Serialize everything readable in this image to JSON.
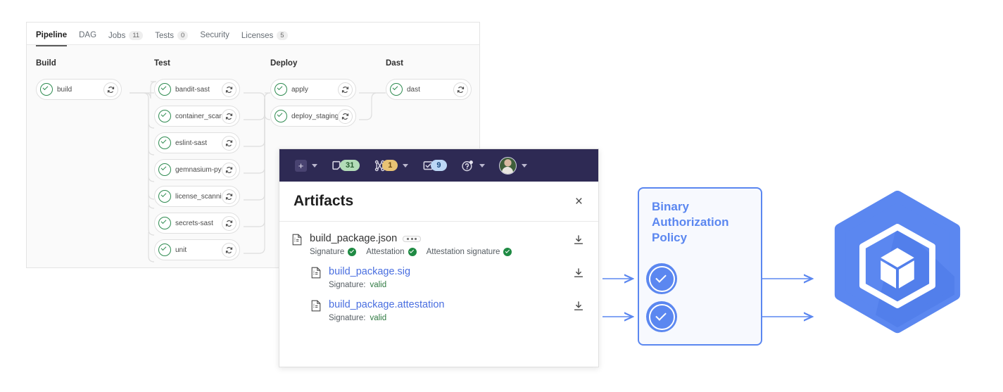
{
  "pipeline": {
    "tabs": [
      {
        "label": "Pipeline",
        "badge": null,
        "active": true
      },
      {
        "label": "DAG",
        "badge": null,
        "active": false
      },
      {
        "label": "Jobs",
        "badge": "11",
        "active": false
      },
      {
        "label": "Tests",
        "badge": "0",
        "active": false
      },
      {
        "label": "Security",
        "badge": null,
        "active": false
      },
      {
        "label": "Licenses",
        "badge": "5",
        "active": false
      }
    ],
    "stages": [
      {
        "name": "Build",
        "jobs": [
          {
            "name": "build",
            "status": "passed",
            "action": "retry"
          }
        ]
      },
      {
        "name": "Test",
        "jobs": [
          {
            "name": "bandit-sast",
            "status": "passed",
            "action": "retry"
          },
          {
            "name": "container_scan...",
            "status": "passed",
            "action": "retry"
          },
          {
            "name": "eslint-sast",
            "status": "passed",
            "action": "retry"
          },
          {
            "name": "gemnasium-pyt...",
            "status": "passed",
            "action": "retry"
          },
          {
            "name": "license_scanning",
            "status": "passed",
            "action": "retry"
          },
          {
            "name": "secrets-sast",
            "status": "passed",
            "action": "retry"
          },
          {
            "name": "unit",
            "status": "passed",
            "action": "retry"
          }
        ]
      },
      {
        "name": "Deploy",
        "jobs": [
          {
            "name": "apply",
            "status": "passed",
            "action": "retry"
          },
          {
            "name": "deploy_staging",
            "status": "passed",
            "action": "retry"
          }
        ]
      },
      {
        "name": "Dast",
        "jobs": [
          {
            "name": "dast",
            "status": "passed",
            "action": "retry"
          }
        ]
      }
    ]
  },
  "navbar": {
    "plus_icon": "plus-icon",
    "items": [
      {
        "icon": "issues-icon",
        "count": "31",
        "color": "#b3dcb8",
        "text_color": "#275c30",
        "chevron": false
      },
      {
        "icon": "merge-request-icon",
        "count": "1",
        "color": "#e8c374",
        "text_color": "#6b4a12",
        "chevron": true
      },
      {
        "icon": "todos-icon",
        "count": "9",
        "color": "#bcd7f5",
        "text_color": "#1b4a80",
        "chevron": false
      },
      {
        "icon": "help-icon",
        "count": null,
        "color": null,
        "text_color": null,
        "chevron": true
      }
    ],
    "avatar_alt": "user-avatar"
  },
  "artifacts": {
    "title": "Artifacts",
    "close_label": "×",
    "rows": [
      {
        "name": "build_package.json",
        "is_link": false,
        "has_menu": true,
        "badges": [
          {
            "label": "Signature",
            "state": "ok"
          },
          {
            "label": "Attestation",
            "state": "ok"
          },
          {
            "label": "Attestation signature",
            "state": "ok"
          }
        ],
        "download": "download-icon"
      },
      {
        "name": "build_package.sig",
        "is_link": true,
        "has_menu": false,
        "sub_label": "Signature:",
        "sub_value": "valid",
        "download": "download-icon"
      },
      {
        "name": "build_package.attestation",
        "is_link": true,
        "has_menu": false,
        "sub_label": "Signature:",
        "sub_value": "valid",
        "download": "download-icon"
      }
    ]
  },
  "policy": {
    "title": "Binary Authorization Policy",
    "check_count": 2,
    "accent": "#5b87f0"
  },
  "gke": {
    "logo_alt": "google-kubernetes-engine-logo",
    "color": "#5b87f0"
  }
}
